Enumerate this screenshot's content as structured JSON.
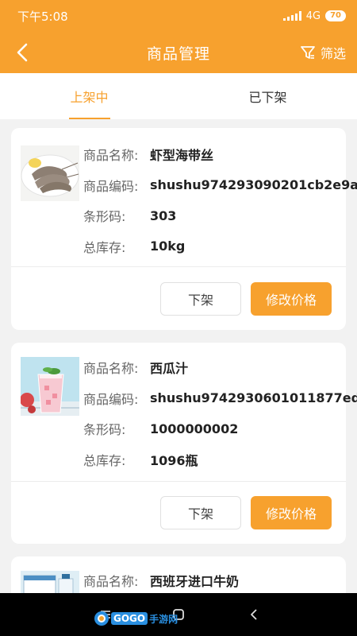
{
  "status_bar": {
    "time": "下午5:08",
    "network": "4G",
    "battery": "70"
  },
  "header": {
    "title": "商品管理",
    "filter_label": "筛选"
  },
  "tabs": [
    {
      "label": "上架中",
      "active": true
    },
    {
      "label": "已下架",
      "active": false
    }
  ],
  "products": [
    {
      "name_label": "商品名称:",
      "name": "虾型海带丝",
      "code_label": "商品编码:",
      "code": "shushu974293090201cb2e9a",
      "barcode_label": "条形码:",
      "barcode": "303",
      "stock_label": "总库存:",
      "stock": "10kg",
      "image": "shrimp-image",
      "off_shelf_label": "下架",
      "edit_price_label": "修改价格"
    },
    {
      "name_label": "商品名称:",
      "name": "西瓜汁",
      "code_label": "商品编码:",
      "code": "shushu9742930601011877ed",
      "barcode_label": "条形码:",
      "barcode": "1000000002",
      "stock_label": "总库存:",
      "stock": "1096瓶",
      "image": "watermelon-juice-image",
      "off_shelf_label": "下架",
      "edit_price_label": "修改价格"
    },
    {
      "name_label": "商品名称:",
      "name": "西班牙进口牛奶",
      "image": "milk-image"
    }
  ],
  "watermark": {
    "text_a": "GOGO",
    "text_b": "手游网"
  },
  "colors": {
    "accent": "#f7a12e",
    "background": "#f2f2f2",
    "card": "#ffffff"
  }
}
